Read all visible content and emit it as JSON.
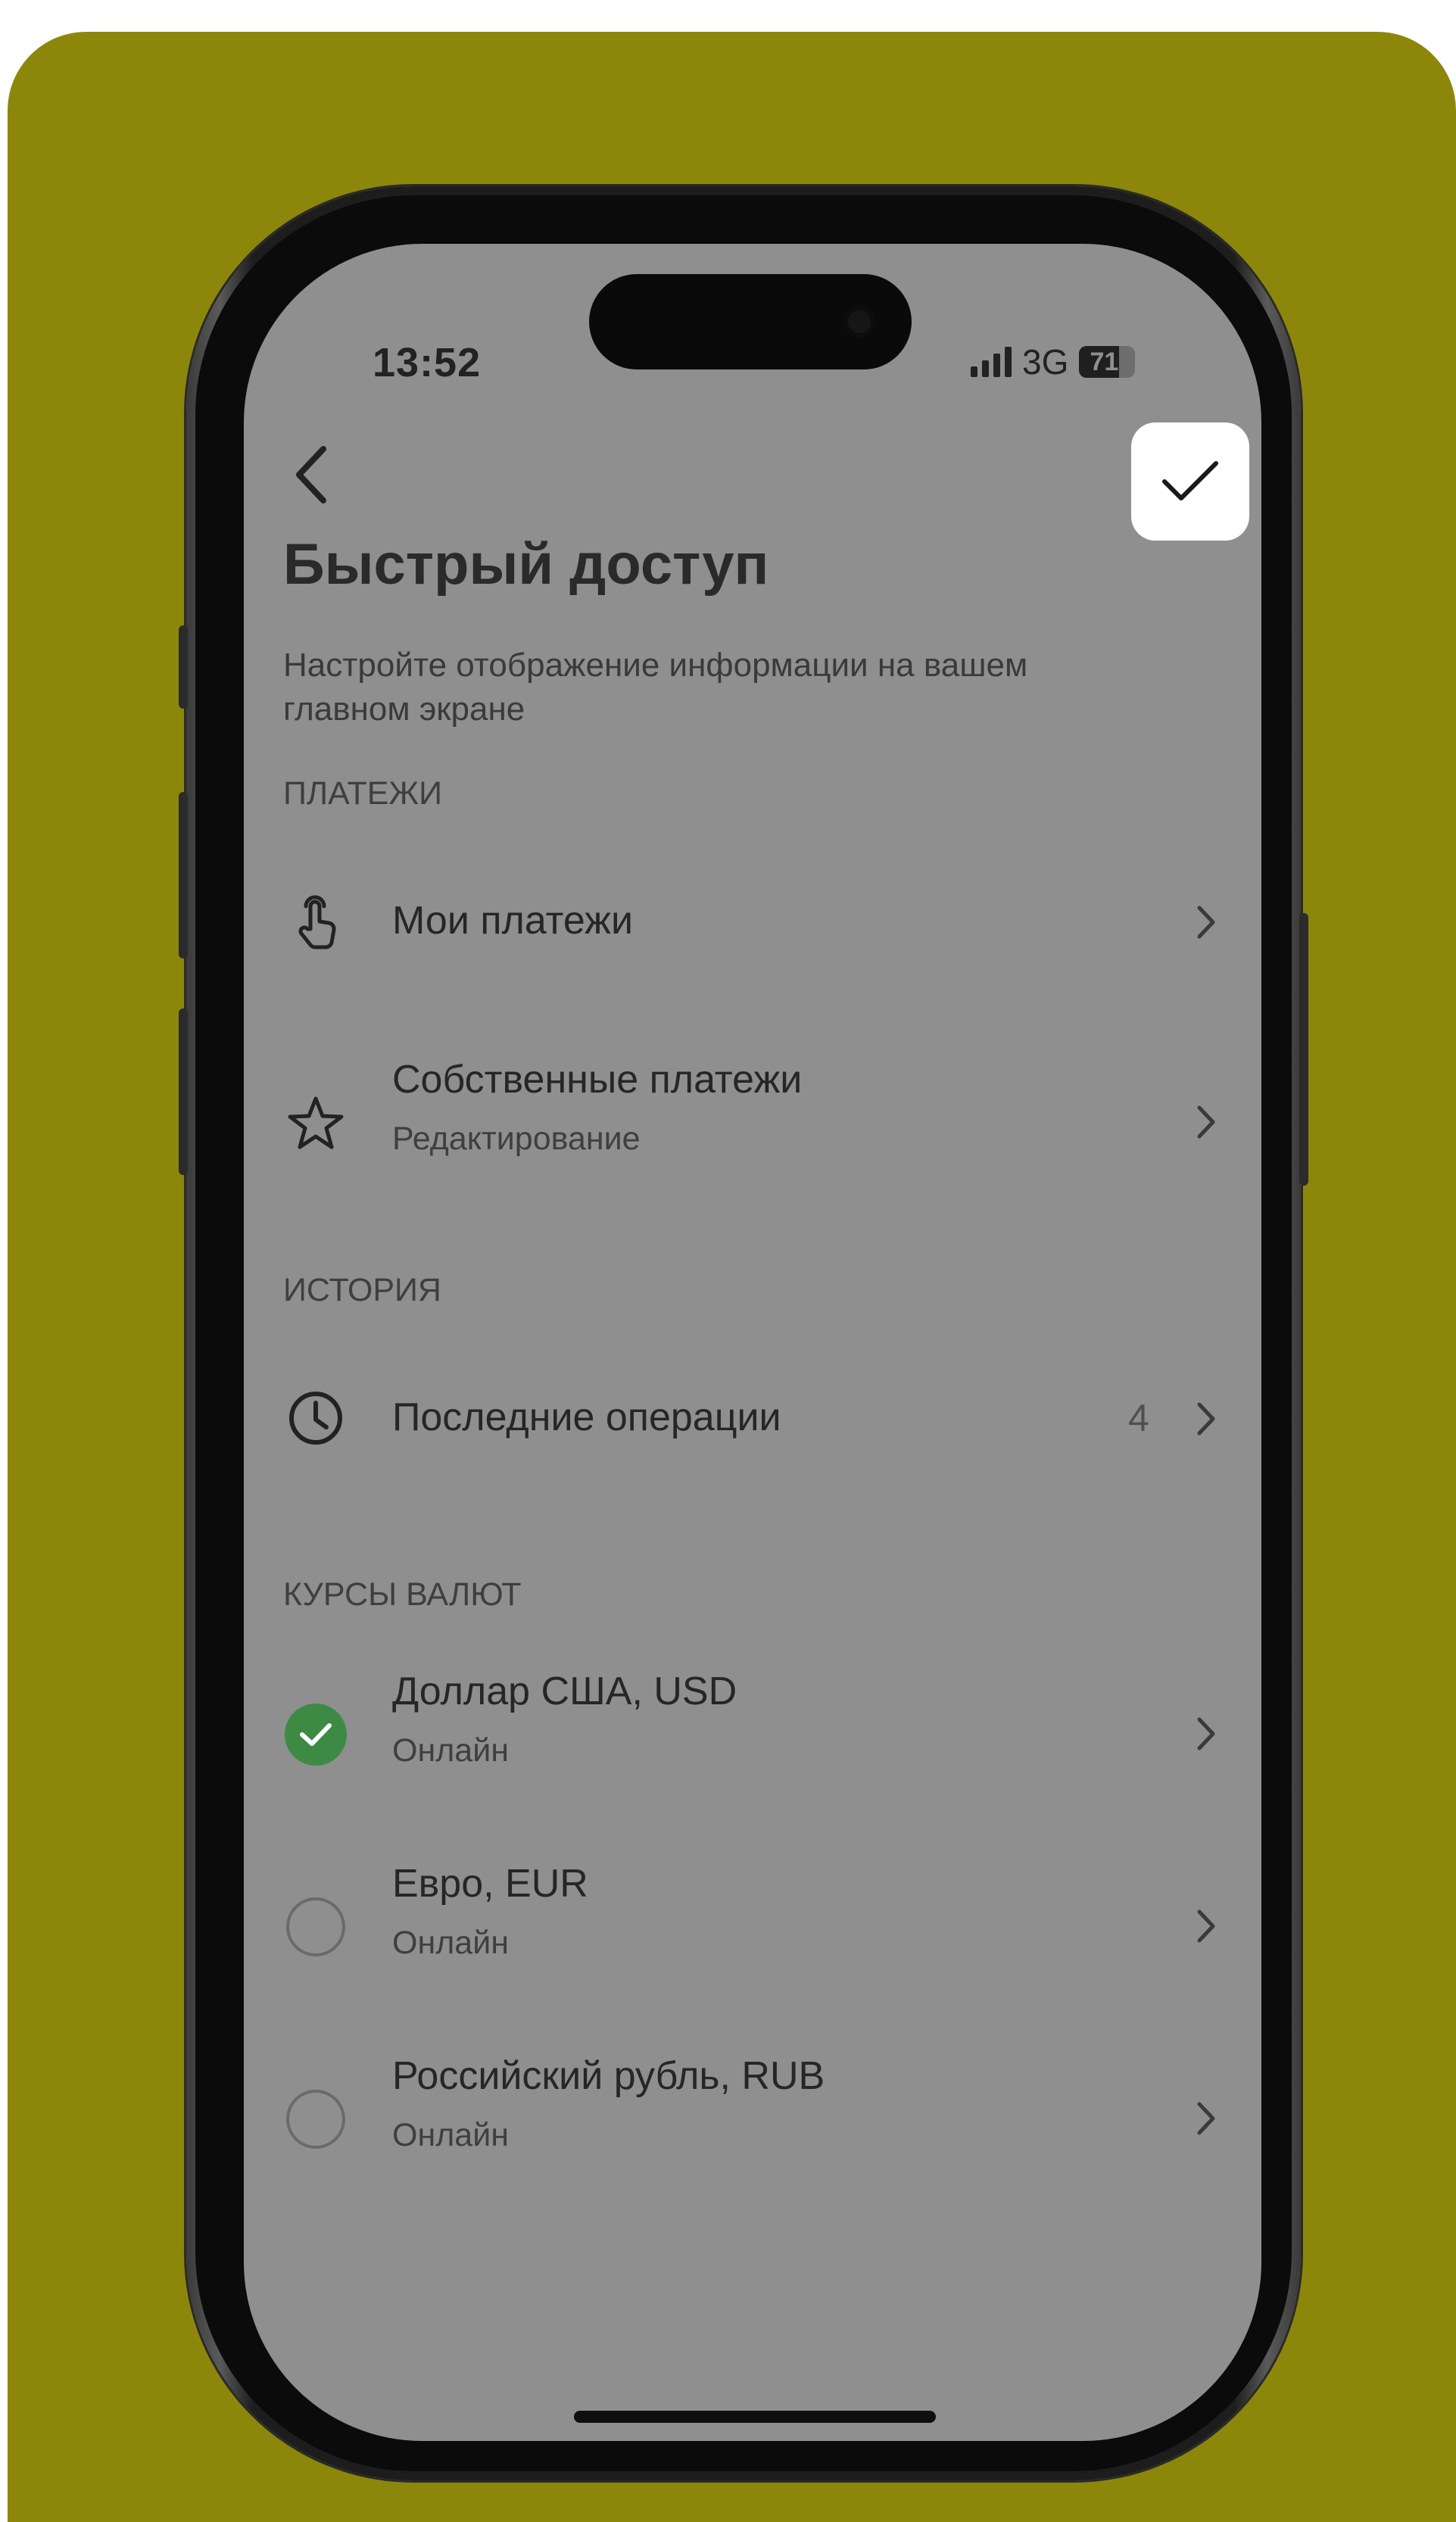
{
  "colors": {
    "background_accent": "#8c870b",
    "screen_overlay": "#8f8f8f",
    "selected_green": "#3d8a45",
    "confirm_button_bg": "#ffffff"
  },
  "status_bar": {
    "time": "13:52",
    "network": "3G",
    "battery": "71",
    "battery_level": 0.71,
    "signal_bars": 4
  },
  "header": {
    "back_icon": "chevron-left-icon",
    "confirm_icon": "checkmark-icon"
  },
  "page": {
    "title": "Быстрый доступ",
    "subtitle": "Настройте отображение информации на вашем главном экране"
  },
  "sections": {
    "payments": {
      "header": "ПЛАТЕЖИ",
      "items": [
        {
          "title": "Мои платежи",
          "icon": "tap-finger-icon"
        },
        {
          "title": "Собственные платежи",
          "subtitle": "Редактирование",
          "icon": "star-icon"
        }
      ]
    },
    "history": {
      "header": "ИСТОРИЯ",
      "items": [
        {
          "title": "Последние операции",
          "count": "4",
          "icon": "clock-icon"
        }
      ]
    },
    "currencies": {
      "header": "КУРСЫ ВАЛЮТ",
      "items": [
        {
          "title": "Доллар США, USD",
          "subtitle": "Онлайн",
          "selected": true
        },
        {
          "title": "Евро, EUR",
          "subtitle": "Онлайн",
          "selected": false
        },
        {
          "title": "Российский рубль, RUB",
          "subtitle": "Онлайн",
          "selected": false
        }
      ]
    }
  }
}
